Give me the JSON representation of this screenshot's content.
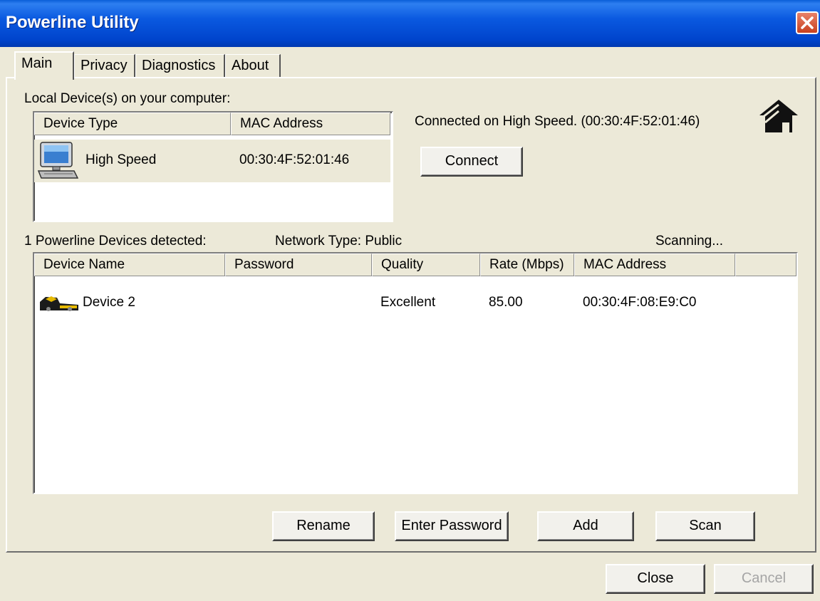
{
  "window": {
    "title": "Powerline Utility",
    "close_icon": "close-icon"
  },
  "tabs": [
    {
      "label": "Main",
      "active": true
    },
    {
      "label": "Privacy"
    },
    {
      "label": "Diagnostics"
    },
    {
      "label": "About"
    }
  ],
  "local": {
    "section_label": "Local Device(s) on your computer:",
    "columns": [
      "Device Type",
      "MAC Address"
    ],
    "row": {
      "icon": "computer-icon",
      "type": "High Speed",
      "mac": "00:30:4F:52:01:46"
    },
    "status": "Connected on  High Speed. (00:30:4F:52:01:46)",
    "connect_label": "Connect",
    "house_icon": "house-icon"
  },
  "remote": {
    "detected": "1 Powerline Devices detected:",
    "network_type": "Network Type: Public",
    "scan_status": "Scanning...",
    "columns": [
      "Device Name",
      "Password",
      "Quality",
      "Rate (Mbps)",
      "MAC Address"
    ],
    "rows": [
      {
        "icon": "powerline-device-icon",
        "name": "Device 2",
        "password": "",
        "quality": "Excellent",
        "rate": "85.00",
        "mac": "00:30:4F:08:E9:C0"
      }
    ]
  },
  "actions": {
    "rename": "Rename",
    "enter_password": "Enter Password",
    "add": "Add",
    "scan": "Scan"
  },
  "footer": {
    "close": "Close",
    "cancel": "Cancel"
  },
  "colors": {
    "titlebar": "#0a59e0",
    "dialog_bg": "#ece9d8",
    "selection": "#ece9d8",
    "close_button": "#d9532e"
  }
}
